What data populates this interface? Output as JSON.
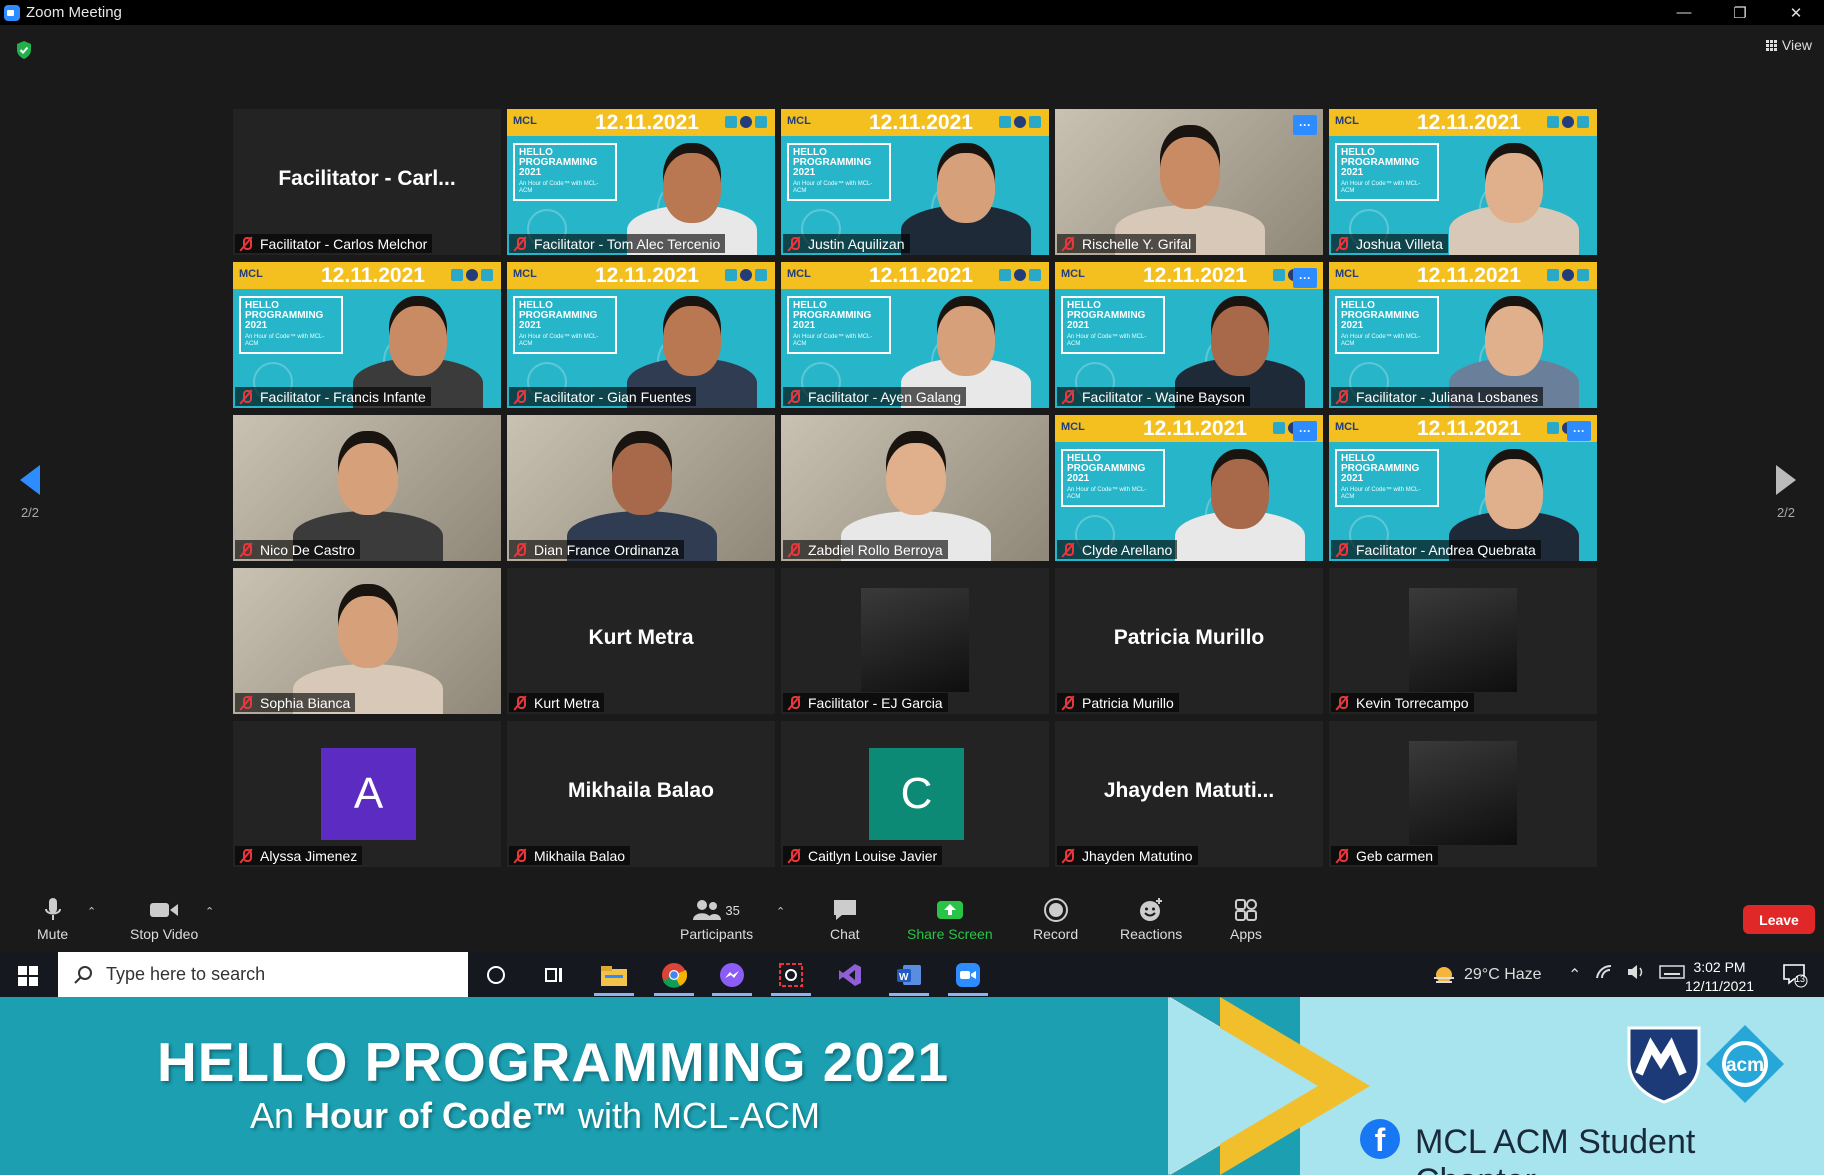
{
  "window": {
    "title": "Zoom Meeting",
    "minimize": "—",
    "restore": "❐",
    "close": "✕"
  },
  "view_label": "View",
  "pagination": {
    "left": "2/2",
    "right": "2/2"
  },
  "banner": {
    "date": "12.11.2021",
    "logo": "MCL",
    "line1": "HELLO",
    "line2": "PROGRAMMING",
    "line3": "2021",
    "sub": "An Hour of Code™ with MCL-ACM"
  },
  "tiles": [
    {
      "name": "Facilitator - Carlos Melchor",
      "type": "name",
      "display": "Facilitator - Carl..."
    },
    {
      "name": "Facilitator - Tom Alec Tercenio",
      "type": "banner"
    },
    {
      "name": "Justin Aquilizan",
      "type": "banner"
    },
    {
      "name": "Rischelle Y. Grifal",
      "type": "video",
      "more": true
    },
    {
      "name": "Joshua Villeta",
      "type": "banner"
    },
    {
      "name": "Facilitator - Francis Infante",
      "type": "banner"
    },
    {
      "name": "Facilitator - Gian Fuentes",
      "type": "banner"
    },
    {
      "name": "Facilitator - Ayen Galang",
      "type": "banner"
    },
    {
      "name": "Facilitator - Waine Bayson",
      "type": "banner",
      "more": true
    },
    {
      "name": "Facilitator - Juliana Losbanes",
      "type": "banner"
    },
    {
      "name": "Nico De Castro",
      "type": "video"
    },
    {
      "name": "Dian France Ordinanza",
      "type": "video"
    },
    {
      "name": "Zabdiel Rollo Berroya",
      "type": "video"
    },
    {
      "name": "Clyde Arellano",
      "type": "banner",
      "more": true
    },
    {
      "name": "Facilitator - Andrea Quebrata",
      "type": "banner",
      "more": true
    },
    {
      "name": "Sophia Bianca",
      "type": "video"
    },
    {
      "name": "Kurt Metra",
      "type": "name",
      "display": "Kurt Metra"
    },
    {
      "name": "Facilitator - EJ Garcia",
      "type": "photo"
    },
    {
      "name": "Patricia Murillo",
      "type": "name",
      "display": "Patricia Murillo"
    },
    {
      "name": "Kevin Torrecampo",
      "type": "photo"
    },
    {
      "name": "Alyssa Jimenez",
      "type": "avatar",
      "letter": "A",
      "color": "#5b2bc2"
    },
    {
      "name": "Mikhaila Balao",
      "type": "name",
      "display": "Mikhaila Balao"
    },
    {
      "name": "Caitlyn Louise Javier",
      "type": "avatar",
      "letter": "C",
      "color": "#0d8a75"
    },
    {
      "name": "Jhayden Matutino",
      "type": "name",
      "display": "Jhayden  Matuti..."
    },
    {
      "name": "Geb carmen",
      "type": "photo"
    }
  ],
  "controls": {
    "mute": "Mute",
    "stop_video": "Stop Video",
    "participants": "Participants",
    "participants_count": "35",
    "chat": "Chat",
    "share_screen": "Share Screen",
    "record": "Record",
    "reactions": "Reactions",
    "apps": "Apps",
    "leave": "Leave"
  },
  "taskbar": {
    "search_placeholder": "Type here to search",
    "weather": "29°C  Haze",
    "time": "3:02 PM",
    "date": "12/11/2021",
    "notifications": "13"
  },
  "lower_third": {
    "title": "HELLO PROGRAMMING 2021",
    "sub_prefix": "An ",
    "sub_bold": "Hour of Code™",
    "sub_suffix": " with MCL-ACM",
    "page_name": "MCL ACM Student Chapter",
    "acm_label": "acm"
  },
  "colors": {
    "accent": "#2d8cff",
    "leave": "#e02828",
    "share": "#29c447",
    "banner_teal": "#27b5c9",
    "banner_yellow": "#f4c020"
  }
}
